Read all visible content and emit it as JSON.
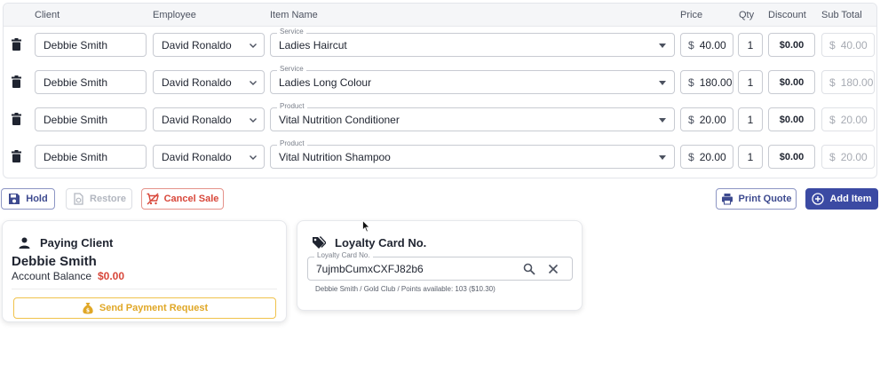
{
  "table": {
    "headers": {
      "client": "Client",
      "employee": "Employee",
      "item_name": "Item Name",
      "price": "Price",
      "qty": "Qty",
      "discount": "Discount",
      "sub_total": "Sub Total"
    },
    "rows": [
      {
        "client": "Debbie Smith",
        "employee": "David Ronaldo",
        "item_type": "Service",
        "item": "Ladies Haircut",
        "currency": "$",
        "price": "40.00",
        "qty": "1",
        "discount": "$0.00",
        "subtotal": "40.00"
      },
      {
        "client": "Debbie Smith",
        "employee": "David Ronaldo",
        "item_type": "Service",
        "item": "Ladies Long Colour",
        "currency": "$",
        "price": "180.00",
        "qty": "1",
        "discount": "$0.00",
        "subtotal": "180.00"
      },
      {
        "client": "Debbie Smith",
        "employee": "David Ronaldo",
        "item_type": "Product",
        "item": "Vital Nutrition Conditioner",
        "currency": "$",
        "price": "20.00",
        "qty": "1",
        "discount": "$0.00",
        "subtotal": "20.00"
      },
      {
        "client": "Debbie Smith",
        "employee": "David Ronaldo",
        "item_type": "Product",
        "item": "Vital Nutrition Shampoo",
        "currency": "$",
        "price": "20.00",
        "qty": "1",
        "discount": "$0.00",
        "subtotal": "20.00"
      }
    ]
  },
  "actions": {
    "hold": "Hold",
    "restore": "Restore",
    "cancel_sale": "Cancel Sale",
    "print_quote": "Print Quote",
    "add_item": "Add Item"
  },
  "paying_client": {
    "title": "Paying Client",
    "name": "Debbie Smith",
    "balance_label": "Account Balance",
    "balance_value": "$0.00",
    "send_payment": "Send Payment Request"
  },
  "loyalty": {
    "title": "Loyalty Card No.",
    "field_label": "Loyalty Card No.",
    "field_value": "7ujmbCumxCXFJ82b6",
    "info": "Debbie Smith / Gold Club / Points available: 103 ($10.30)"
  },
  "icons": {
    "delete": "trash-icon",
    "hold": "floppy-disk-icon",
    "restore": "restore-icon",
    "cancel": "cart-cancel-icon",
    "print": "printer-icon",
    "add": "plus-circle-icon",
    "client": "person-icon",
    "loyalty": "tags-icon",
    "payment": "money-bag-icon",
    "search": "search-icon",
    "clear": "close-icon"
  },
  "colors": {
    "primary": "#3b4aa3",
    "danger": "#d8473a",
    "warning": "#e0a726"
  }
}
